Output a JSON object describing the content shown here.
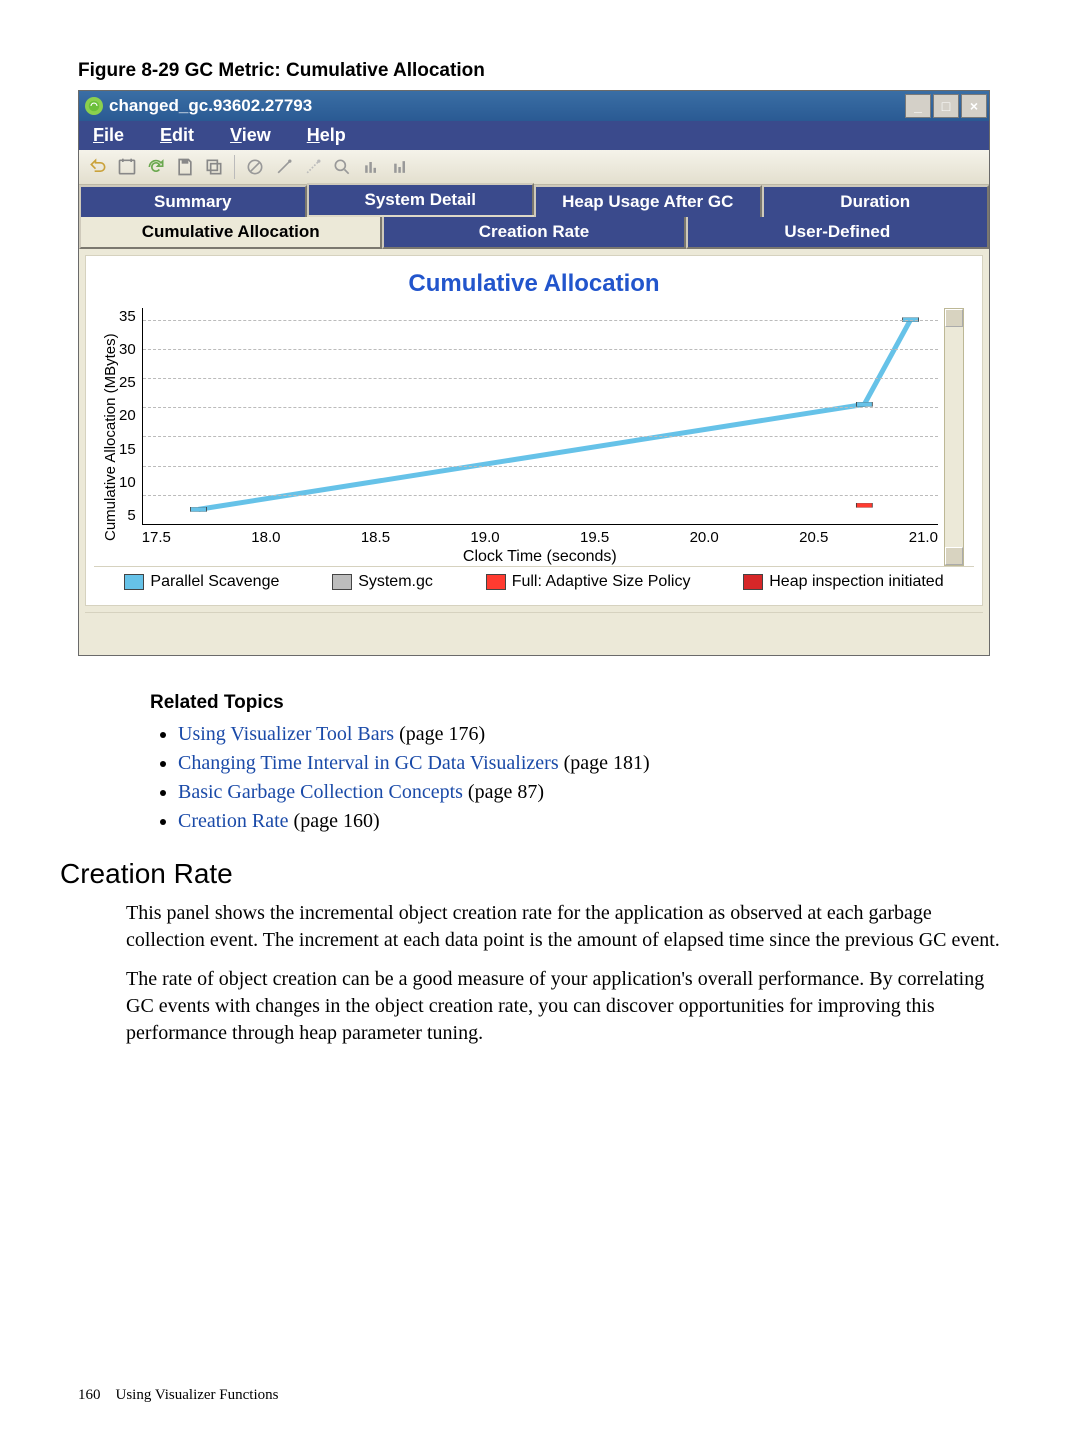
{
  "figure_caption": "Figure 8-29 GC Metric: Cumulative Allocation",
  "window": {
    "title": "changed_gc.93602.27793",
    "menus": [
      "File",
      "Edit",
      "View",
      "Help"
    ],
    "tabs_row1": [
      "Summary",
      "System Detail",
      "Heap Usage After GC",
      "Duration"
    ],
    "tabs_row2": [
      "Cumulative Allocation",
      "Creation Rate",
      "User-Defined"
    ],
    "active_tab": "Cumulative Allocation"
  },
  "chart_data": {
    "type": "line",
    "title": "Cumulative Allocation",
    "xlabel": "Clock Time  (seconds)",
    "ylabel": "Cumulative Allocation  (MBytes)",
    "ylim": [
      0,
      37
    ],
    "yticks": [
      5,
      10,
      15,
      20,
      25,
      30,
      35
    ],
    "xticks": [
      17.5,
      18.0,
      18.5,
      19.0,
      19.5,
      20.0,
      20.5,
      21.0
    ],
    "xlim": [
      17.1,
      21.4
    ],
    "series": [
      {
        "name": "Parallel Scavenge",
        "color": "#66c2e8",
        "points": [
          [
            17.4,
            2.5
          ],
          [
            21.0,
            20.5
          ],
          [
            21.25,
            35.0
          ]
        ]
      },
      {
        "name": "System.gc",
        "color": "#bdbdbd",
        "points": []
      },
      {
        "name": "Full: Adaptive Size Policy",
        "color": "#ff3b30",
        "points": [
          [
            21.0,
            3.2
          ]
        ]
      },
      {
        "name": "Heap inspection initiated",
        "color": "#d62728",
        "points": []
      }
    ],
    "legend": [
      {
        "label": "Parallel Scavenge",
        "color": "#66c2e8"
      },
      {
        "label": "System.gc",
        "color": "#bdbdbd"
      },
      {
        "label": "Full: Adaptive Size Policy",
        "color": "#ff3b30"
      },
      {
        "label": "Heap inspection initiated",
        "color": "#d62728"
      }
    ]
  },
  "related_heading": "Related Topics",
  "related": [
    {
      "text": "Using Visualizer Tool Bars",
      "page": "(page 176)"
    },
    {
      "text": "Changing Time Interval in GC Data Visualizers",
      "page": "(page 181)"
    },
    {
      "text": "Basic Garbage Collection Concepts",
      "page": "(page 87)"
    },
    {
      "text": "Creation Rate",
      "page": "(page 160)"
    }
  ],
  "section_heading": "Creation Rate",
  "para1": "This panel shows the incremental object creation rate for the application as observed at each garbage collection event. The increment at each data point is the amount of elapsed time since the previous GC event.",
  "para2": "The rate of object creation can be a good measure of your application's overall performance. By correlating GC events with changes in the object creation rate, you can discover opportunities for improving this performance through heap parameter tuning.",
  "footer": {
    "page": "160",
    "title": "Using Visualizer Functions"
  }
}
